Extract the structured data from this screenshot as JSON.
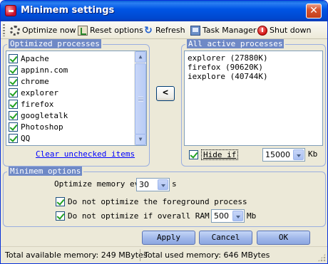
{
  "window": {
    "title": "Minimem settings",
    "close_glyph": "✕"
  },
  "toolbar": {
    "items": [
      {
        "label": "Optimize now",
        "icon": "optimize-icon"
      },
      {
        "label": "Reset options",
        "icon": "reset-icon"
      },
      {
        "label": "Refresh",
        "icon": "refresh-icon"
      },
      {
        "label": "Task Manager",
        "icon": "task-manager-icon"
      },
      {
        "label": "Shut down",
        "icon": "shut-down-icon"
      }
    ]
  },
  "optimized_processes": {
    "title": "Optimized processes",
    "items": [
      {
        "name": "Apache",
        "checked": true
      },
      {
        "name": "appinn.com",
        "checked": true
      },
      {
        "name": "chrome",
        "checked": true
      },
      {
        "name": "explorer",
        "checked": true
      },
      {
        "name": "firefox",
        "checked": true
      },
      {
        "name": "googletalk",
        "checked": true
      },
      {
        "name": "Photoshop",
        "checked": true
      },
      {
        "name": "QQ",
        "checked": true
      }
    ],
    "clear_link": "Clear unchecked items"
  },
  "move_button": {
    "label": "<"
  },
  "active_processes": {
    "title": "All active processes",
    "items": [
      "explorer (27880K)",
      "firefox (90620K)",
      "iexplore (40744K)"
    ],
    "hide_if_label": "Hide if",
    "hide_if_checked": true,
    "hide_if_value": "15000",
    "unit": "Kb"
  },
  "options": {
    "title": "Minimem options",
    "optimize_every_label": "Optimize memory eve",
    "optimize_every_value": "30",
    "optimize_every_unit": "s",
    "no_foreground_label": "Do not optimize the foreground process",
    "no_foreground_checked": true,
    "ram_label": "Do not optimize if overall RAM av",
    "ram_checked": true,
    "ram_value": "500",
    "ram_unit": "Mb"
  },
  "buttons": {
    "apply": "Apply",
    "cancel": "Cancel",
    "ok": "OK"
  },
  "status": {
    "available": "Total available memory: 249 MBytes",
    "used": "Total used memory: 646 MBytes"
  }
}
